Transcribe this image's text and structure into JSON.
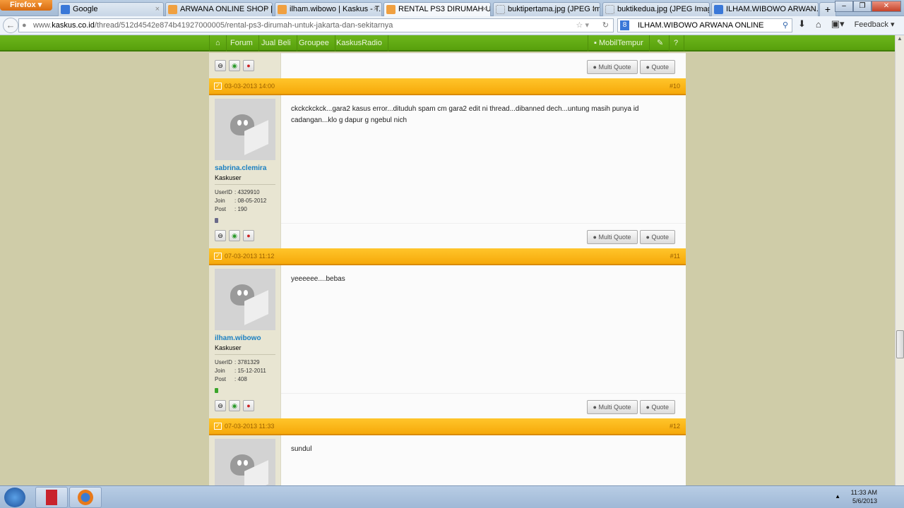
{
  "browser": {
    "menu_label": "Firefox",
    "tabs": [
      {
        "label": "Google",
        "icon": "google-icon"
      },
      {
        "label": "ARWANA ONLINE SHOP | ...",
        "icon": "kaskus-icon"
      },
      {
        "label": "ilham.wibowo | Kaskus - T...",
        "icon": "kaskus-icon"
      },
      {
        "label": "RENTAL PS3 DIRUMAH U...",
        "icon": "kaskus-icon",
        "active": true
      },
      {
        "label": "buktipertama.jpg (JPEG Im...",
        "icon": "image-icon"
      },
      {
        "label": "buktikedua.jpg (JPEG Imag...",
        "icon": "image-icon"
      },
      {
        "label": "ILHAM.WIBOWO ARWAN...",
        "icon": "google-icon"
      }
    ],
    "url_prefix": "www.",
    "url_domain": "kaskus.co.id",
    "url_path": "/thread/512d4542e874b41927000005/rental-ps3-dirumah-untuk-jakarta-dan-sekitarnya",
    "search_value": "ILHAM.WIBOWO ARWANA ONLINE",
    "feedback_label": "Feedback"
  },
  "site_nav": {
    "items": [
      "Forum",
      "Jual Beli",
      "Groupee",
      "KaskusRadio"
    ],
    "username": "MobilTempur",
    "accent": "#5ea912"
  },
  "buttons": {
    "multi_quote": "Multi Quote",
    "quote": "Quote"
  },
  "posts": [
    {
      "date": "03-03-2013 14:00",
      "number": "#10",
      "username": "sabrina.clemira",
      "rank": "Kaskuser",
      "userid": "4329910",
      "join": "08-05-2012",
      "post_count": "190",
      "rep_color": "#6a6a8a",
      "content": "ckckckckck...gara2 kasus error...dituduh spam cm gara2 edit ni thread...dibanned dech...untung masih punya id cadangan...klo g dapur g ngebul nich"
    },
    {
      "date": "07-03-2013 11:12",
      "number": "#11",
      "username": "ilham.wibowo",
      "rank": "Kaskuser",
      "userid": "3781329",
      "join": "15-12-2011",
      "post_count": "408",
      "rep_color": "#3aa52a",
      "content": "yeeeeee....bebas"
    },
    {
      "date": "07-03-2013 11:33",
      "number": "#12",
      "content": "sundul"
    }
  ],
  "labels": {
    "userid": "UserID",
    "join": "Join",
    "post": "Post"
  },
  "taskbar": {
    "time": "11:33 AM",
    "date": "5/6/2013"
  }
}
